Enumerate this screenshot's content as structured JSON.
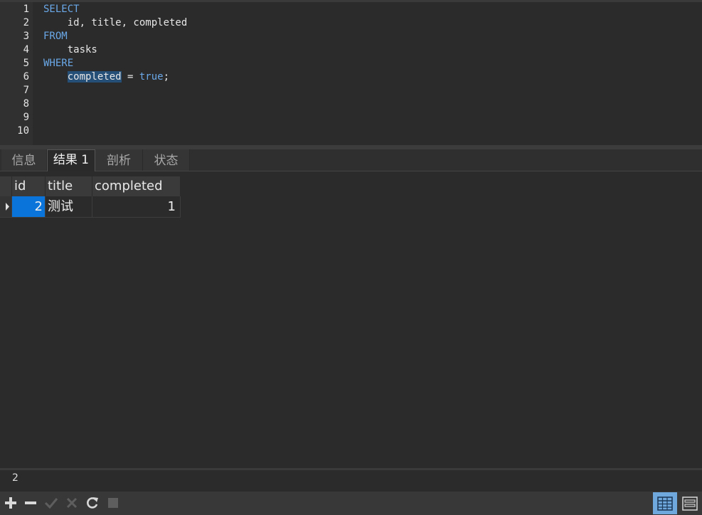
{
  "editor": {
    "line_numbers": [
      "1",
      "2",
      "3",
      "4",
      "5",
      "6",
      "7",
      "8",
      "9",
      "10"
    ],
    "lines": {
      "l1_kw": "SELECT",
      "l2": "    id, title, completed",
      "l3_kw": "FROM",
      "l4": "    tasks",
      "l5_kw": "WHERE",
      "l6_indent": "    ",
      "l6_sel": "completed",
      "l6_eq": " = ",
      "l6_kw": "true",
      "l6_end": ";"
    }
  },
  "tabs": [
    {
      "label": "信息",
      "active": false
    },
    {
      "label": "结果 1",
      "active": true
    },
    {
      "label": "剖析",
      "active": false
    },
    {
      "label": "状态",
      "active": false
    }
  ],
  "results": {
    "columns": [
      "id",
      "title",
      "completed"
    ],
    "rows": [
      {
        "id": "2",
        "title": "测试",
        "completed": "1"
      }
    ]
  },
  "status": {
    "value": "2"
  },
  "toolbar": {
    "icons": [
      "add-icon",
      "remove-icon",
      "apply-icon",
      "discard-icon",
      "refresh-icon",
      "stop-icon",
      "grid-view-icon",
      "form-view-icon"
    ]
  },
  "colors": {
    "keyword": "#6aa8e8",
    "selection": "#264f78",
    "selected_cell": "#0a74da",
    "active_view": "#6fa8dc"
  }
}
